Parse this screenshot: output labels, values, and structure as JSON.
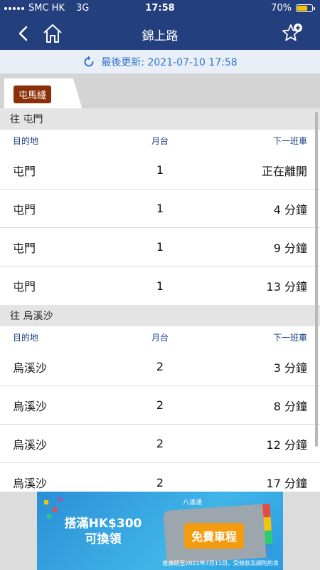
{
  "status": {
    "carrier": "SMC HK",
    "network": "3G",
    "time": "17:58",
    "battery": "70%",
    "battery_level": 0.7
  },
  "nav": {
    "title": "錦上路"
  },
  "update": {
    "text": "最後更新: 2021-07-10 17:58"
  },
  "tab": {
    "label": "屯馬綫"
  },
  "columns": {
    "dest": "目的地",
    "platform": "月台",
    "next": "下一班車"
  },
  "sections": [
    {
      "header": "往 屯門",
      "rows": [
        {
          "dest": "屯門",
          "platform": "1",
          "next": "正在離開"
        },
        {
          "dest": "屯門",
          "platform": "1",
          "next": "4 分鐘"
        },
        {
          "dest": "屯門",
          "platform": "1",
          "next": "9 分鐘"
        },
        {
          "dest": "屯門",
          "platform": "1",
          "next": "13 分鐘"
        }
      ]
    },
    {
      "header": "往 烏溪沙",
      "rows": [
        {
          "dest": "烏溪沙",
          "platform": "2",
          "next": "3 分鐘"
        },
        {
          "dest": "烏溪沙",
          "platform": "2",
          "next": "8 分鐘"
        },
        {
          "dest": "烏溪沙",
          "platform": "2",
          "next": "12 分鐘"
        },
        {
          "dest": "烏溪沙",
          "platform": "2",
          "next": "17 分鐘"
        }
      ]
    }
  ],
  "ad": {
    "line1": "搭滿HK$300",
    "line2": "可換領",
    "badge": "免費車程",
    "brand": "八達通",
    "fine": "推廣期至2021年7月11日，受條款及細則約束"
  },
  "colors": {
    "navbar": "#233f7d",
    "update_text": "#2f77d0",
    "tab_badge": "#8a2f08",
    "battery": "#f5c400"
  }
}
